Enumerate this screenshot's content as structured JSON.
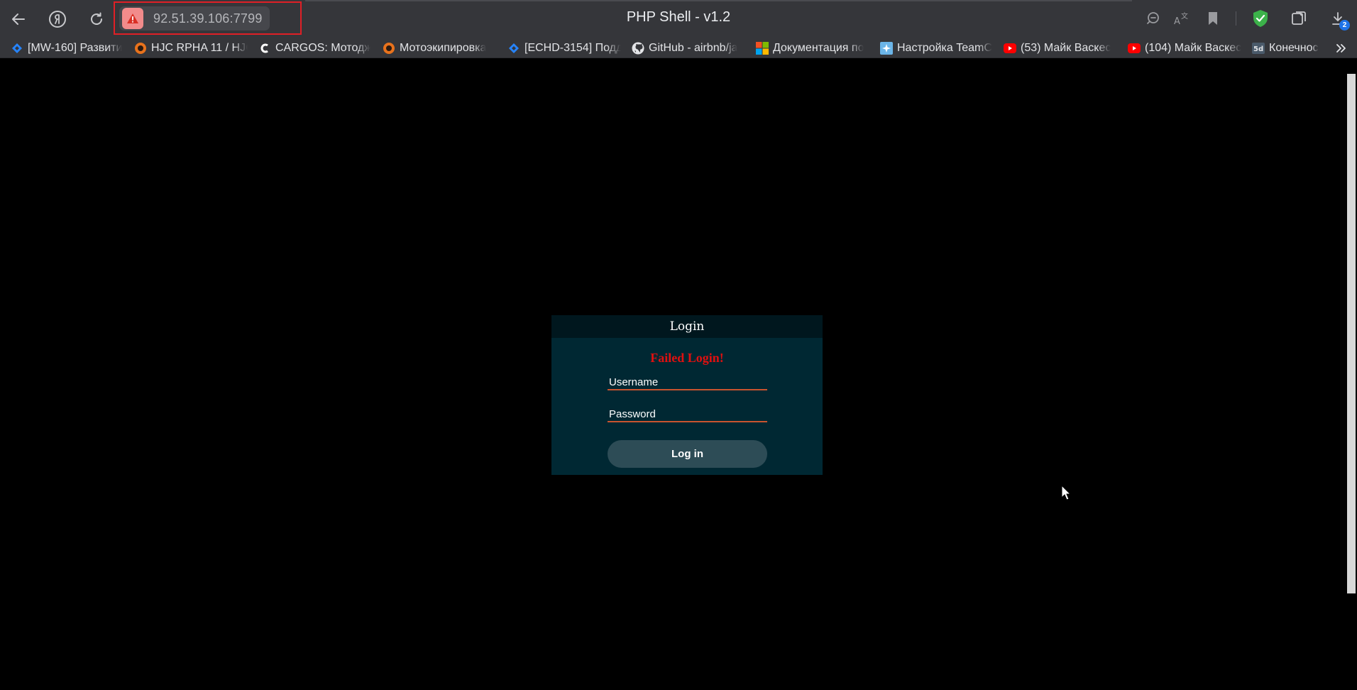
{
  "browser": {
    "title": "PHP Shell - v1.2",
    "address": "92.51.39.106:7799",
    "download_count": "2",
    "accent_color": "#e01f26",
    "icons": [
      "back-icon",
      "yandex-icon",
      "reload-icon",
      "security-warning-icon",
      "zoom-out-icon",
      "translate-icon",
      "bookmark-icon",
      "shield-icon",
      "collections-icon",
      "downloads-icon"
    ]
  },
  "bookmarks": [
    {
      "label": "[MW-160] Развити",
      "icon": "jira-icon"
    },
    {
      "label": "HJC RPHA 11 / HJC",
      "icon": "moto-icon"
    },
    {
      "label": "CARGOS: Мотодж",
      "icon": "cargos-icon"
    },
    {
      "label": "Мотоэкипировка",
      "icon": "moto-icon"
    },
    {
      "label": "[ECHD-3154] Подд",
      "icon": "jira-icon"
    },
    {
      "label": "GitHub - airbnb/ja",
      "icon": "github-icon"
    },
    {
      "label": "Документация по",
      "icon": "microsoft-icon"
    },
    {
      "label": "Настройка TeamC",
      "icon": "teamcity-icon"
    },
    {
      "label": "(53) Майк Васкес",
      "icon": "youtube-icon"
    },
    {
      "label": "(104) Майк Васкес",
      "icon": "youtube-icon"
    },
    {
      "label": "Конечнос",
      "icon": "5d-icon"
    }
  ],
  "login": {
    "heading": "Login",
    "error": "Failed Login!",
    "username_placeholder": "Username",
    "password_placeholder": "Password",
    "submit_label": "Log in"
  }
}
